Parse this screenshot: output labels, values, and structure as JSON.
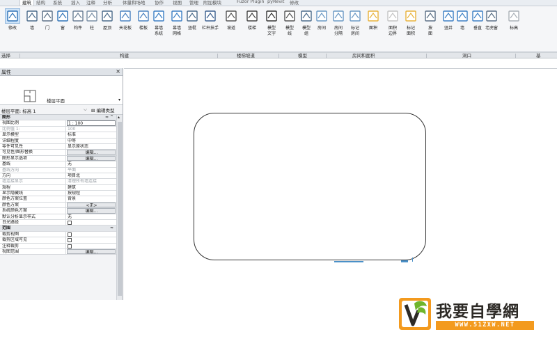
{
  "ribbon": {
    "tabs": [
      "建筑",
      "结构",
      "系统",
      "插入",
      "注释",
      "分析",
      "体量和场地",
      "协作",
      "视图",
      "管理",
      "附加模块",
      "Fuzor Plugin",
      "pyRevit",
      "修改"
    ],
    "active_tab": "建筑",
    "tools": [
      {
        "label": "修改",
        "icon": "cursor-icon",
        "selected": true
      },
      {
        "label": "墙",
        "icon": "wall-icon"
      },
      {
        "label": "门",
        "icon": "door-icon"
      },
      {
        "label": "窗",
        "icon": "window-icon"
      },
      {
        "label": "构件",
        "icon": "component-icon"
      },
      {
        "label": "柱",
        "icon": "column-icon"
      },
      {
        "label": "屋顶",
        "icon": "roof-icon"
      },
      {
        "label": "天花板",
        "icon": "ceiling-icon"
      },
      {
        "label": "楼板",
        "icon": "floor-icon"
      },
      {
        "label": "幕墙\n系统",
        "icon": "curtain-system-icon"
      },
      {
        "label": "幕墙\n网格",
        "icon": "curtain-grid-icon"
      },
      {
        "label": "竖梃",
        "icon": "mullion-icon"
      },
      {
        "label": "栏杆扶手",
        "icon": "railing-icon"
      },
      {
        "label": "坡道",
        "icon": "ramp-icon"
      },
      {
        "label": "楼梯",
        "icon": "stair-icon"
      },
      {
        "label": "模型\n文字",
        "icon": "model-text-icon"
      },
      {
        "label": "模型\n线",
        "icon": "model-line-icon"
      },
      {
        "label": "模型\n组",
        "icon": "model-group-icon"
      },
      {
        "label": "房间",
        "icon": "room-icon"
      },
      {
        "label": "房间\n分隔",
        "icon": "room-separator-icon"
      },
      {
        "label": "标记\n房间",
        "icon": "tag-room-icon"
      },
      {
        "label": "面积",
        "icon": "area-icon"
      },
      {
        "label": "面积\n边界",
        "icon": "area-boundary-icon"
      },
      {
        "label": "标记\n面积",
        "icon": "tag-area-icon"
      },
      {
        "label": "按\n面",
        "icon": "by-face-icon"
      },
      {
        "label": "竖井",
        "icon": "shaft-icon"
      },
      {
        "label": "墙",
        "icon": "wall-opening-icon"
      },
      {
        "label": "垂直",
        "icon": "vertical-opening-icon"
      },
      {
        "label": "老虎窗",
        "icon": "dormer-icon"
      },
      {
        "label": "标高",
        "icon": "level-icon"
      }
    ],
    "panels": [
      "选择",
      "构建",
      "楼梯坡道",
      "模型",
      "房间和面积",
      "洞口",
      "基"
    ]
  },
  "properties": {
    "title": "属性",
    "close": "×",
    "type_name": "楼层平面",
    "filter": "楼层平面: 标高 1",
    "edit_type": "编辑类型",
    "rows": [
      {
        "k": "图形",
        "v": "",
        "group": true,
        "toggle": "≈ ^"
      },
      {
        "k": "视图比例",
        "v": "1 : 100",
        "input": true
      },
      {
        "k": "比例值 1:",
        "v": "100",
        "disabled": true
      },
      {
        "k": "显示模型",
        "v": "标准"
      },
      {
        "k": "详细程度",
        "v": "中等"
      },
      {
        "k": "零件可见性",
        "v": "显示原状态"
      },
      {
        "k": "可见性/图形替换",
        "v": "编辑...",
        "button": true
      },
      {
        "k": "图形显示选项",
        "v": "编辑...",
        "button": true
      },
      {
        "k": "基线",
        "v": "无"
      },
      {
        "k": "基线方向",
        "v": "平面",
        "disabled": true
      },
      {
        "k": "方向",
        "v": "项目北"
      },
      {
        "k": "墙连接显示",
        "v": "清理所有墙连接",
        "disabled": true
      },
      {
        "k": "规程",
        "v": "建筑"
      },
      {
        "k": "显示隐藏线",
        "v": "按规程"
      },
      {
        "k": "颜色方案位置",
        "v": "背景"
      },
      {
        "k": "颜色方案",
        "v": "<无>",
        "button": true
      },
      {
        "k": "系统颜色方案",
        "v": "编辑...",
        "button": true
      },
      {
        "k": "默认分析显示样式",
        "v": "无"
      },
      {
        "k": "日光路径",
        "v": "",
        "checkbox": true
      },
      {
        "k": "范围",
        "v": "",
        "group": true,
        "toggle": "≈"
      },
      {
        "k": "裁剪视图",
        "v": "",
        "checkbox": true
      },
      {
        "k": "裁剪区域可见",
        "v": "",
        "checkbox": true
      },
      {
        "k": "注释裁剪",
        "v": "",
        "checkbox": true
      },
      {
        "k": "视图范围",
        "v": "编辑...",
        "button": true
      }
    ]
  },
  "watermark": {
    "text": "我要自學網",
    "url": "WWW.51ZXW.NET"
  },
  "colors": {
    "accent_blue": "#4a90c8",
    "logo_orange": "#f39a1e",
    "logo_green": "#6fb52c"
  }
}
